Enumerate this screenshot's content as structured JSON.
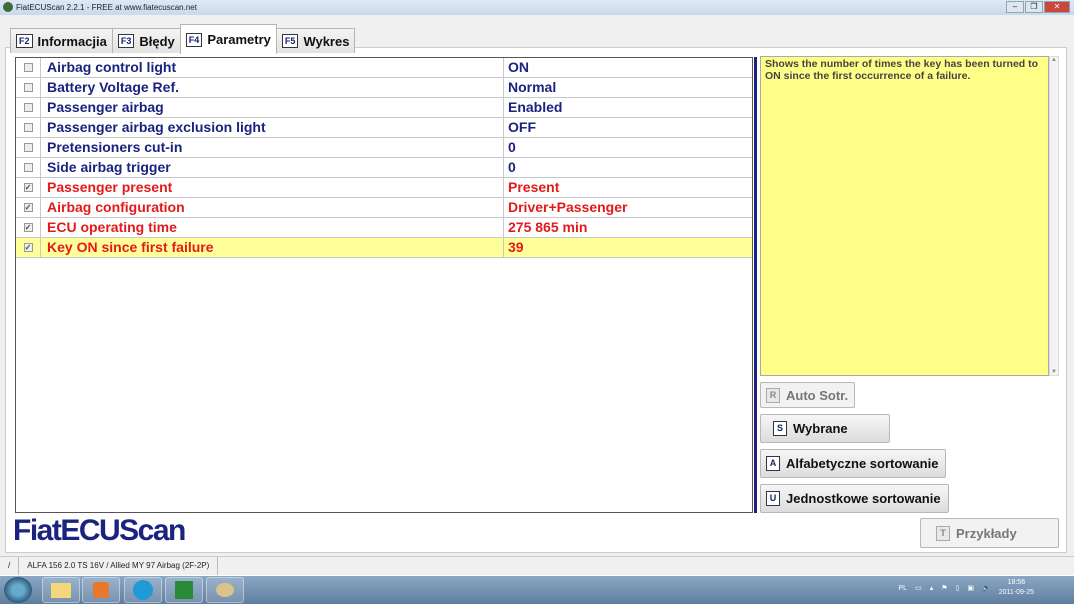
{
  "window": {
    "title": "FiatECUScan 2.2.1 - FREE at www.fiatecuscan.net"
  },
  "tabs": [
    {
      "key": "F2",
      "label": "Informacjia"
    },
    {
      "key": "F3",
      "label": "Błędy"
    },
    {
      "key": "F4",
      "label": "Parametry",
      "active": true
    },
    {
      "key": "F5",
      "label": "Wykres"
    }
  ],
  "parameters": [
    {
      "name": "Airbag control light",
      "value": "ON",
      "checked": false
    },
    {
      "name": "Battery Voltage Ref.",
      "value": "Normal",
      "checked": false
    },
    {
      "name": "Passenger airbag",
      "value": "Enabled",
      "checked": false
    },
    {
      "name": "Passenger airbag exclusion light",
      "value": "OFF",
      "checked": false
    },
    {
      "name": "Pretensioners cut-in",
      "value": "0",
      "checked": false
    },
    {
      "name": "Side airbag trigger",
      "value": "0",
      "checked": false
    },
    {
      "name": "Passenger present",
      "value": "Present",
      "checked": true
    },
    {
      "name": "Airbag configuration",
      "value": "Driver+Passenger",
      "checked": true
    },
    {
      "name": "ECU operating time",
      "value": "275 865 min",
      "checked": true
    },
    {
      "name": "Key ON since first failure",
      "value": "39",
      "checked": true,
      "selected": true
    }
  ],
  "description": "Shows the number of times the key has been turned to ON since the first occurrence of a failure.",
  "buttons": {
    "auto": {
      "key": "R",
      "label": "Auto Sotr."
    },
    "selected": {
      "key": "S",
      "label": "Wybrane"
    },
    "alpha": {
      "key": "A",
      "label": "Alfabetyczne sortowanie"
    },
    "unit": {
      "key": "U",
      "label": "Jednostkowe sortowanie"
    },
    "examples": {
      "key": "T",
      "label": "Przykłady"
    }
  },
  "logo": "FiatECUScan",
  "status": {
    "sep": "/",
    "vehicle": "ALFA 156 2.0 TS 16V / Allied MY 97 Airbag (2F-2P)"
  },
  "taskbar": {
    "lang": "PL",
    "time": "18:56",
    "date": "2011-09-25"
  },
  "colors": {
    "accent": "#1a237e",
    "checked": "#e31a1a",
    "highlight": "#ffff99",
    "description_bg": "#ffff88"
  }
}
